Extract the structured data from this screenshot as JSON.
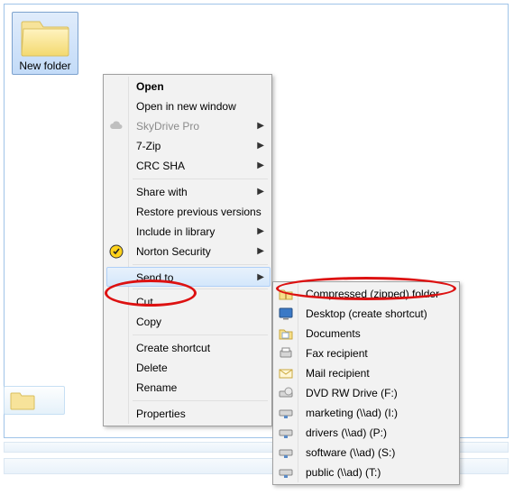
{
  "folder": {
    "label": "New folder"
  },
  "context_menu": {
    "open": "Open",
    "open_new_window": "Open in new window",
    "skydrive_pro": "SkyDrive Pro",
    "seven_zip": "7-Zip",
    "crc_sha": "CRC SHA",
    "share_with": "Share with",
    "restore_previous": "Restore previous versions",
    "include_in_library": "Include in library",
    "norton_security": "Norton Security",
    "send_to": "Send to",
    "cut": "Cut",
    "copy": "Copy",
    "create_shortcut": "Create shortcut",
    "delete": "Delete",
    "rename": "Rename",
    "properties": "Properties"
  },
  "send_to_menu": {
    "compressed": "Compressed (zipped) folder",
    "desktop_shortcut": "Desktop (create shortcut)",
    "documents": "Documents",
    "fax_recipient": "Fax recipient",
    "mail_recipient": "Mail recipient",
    "dvd_drive": "DVD RW Drive (F:)",
    "net_marketing": "marketing (\\\\ad) (I:)",
    "net_drivers": "drivers (\\\\ad) (P:)",
    "net_software": "software (\\\\ad) (S:)",
    "net_public": "public (\\\\ad) (T:)"
  }
}
